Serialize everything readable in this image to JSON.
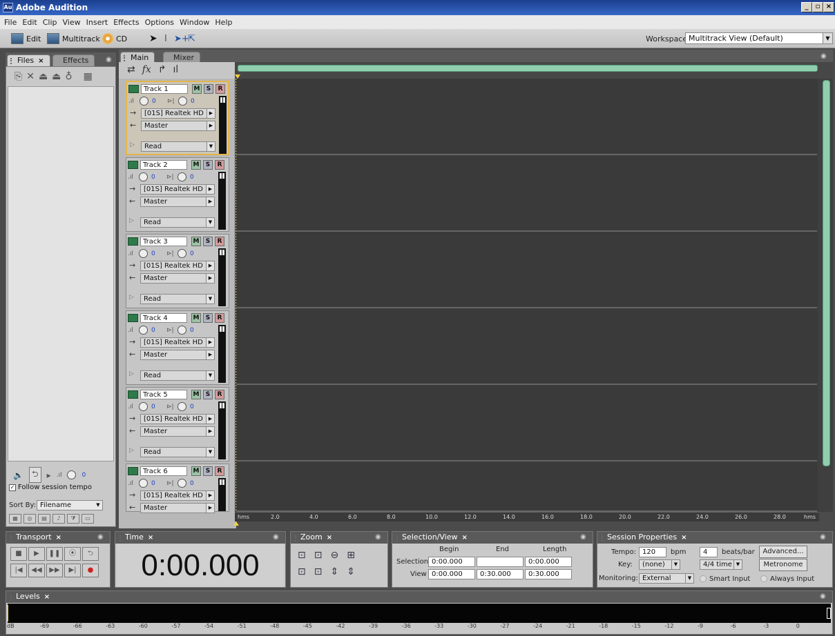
{
  "app": {
    "title": "Adobe Audition",
    "icon_label": "Au"
  },
  "menu": [
    "File",
    "Edit",
    "Clip",
    "View",
    "Insert",
    "Effects",
    "Options",
    "Window",
    "Help"
  ],
  "toolbar": {
    "edit_label": "Edit",
    "multitrack_label": "Multitrack",
    "cd_label": "CD",
    "workspace_label": "Workspace:",
    "workspace_value": "Multitrack View (Default)"
  },
  "left_panel": {
    "tabs": [
      "Files",
      "Effects"
    ],
    "follow_tempo": "Follow session tempo",
    "sort_by_label": "Sort By:",
    "sort_by_value": "Filename",
    "vol_value": "0"
  },
  "main_tabs": [
    "Main",
    "Mixer"
  ],
  "tracks": [
    {
      "name": "Track 1",
      "vol": "0",
      "pan": "0",
      "input": "[01S] Realtek HD",
      "output": "Master",
      "automation": "Read"
    },
    {
      "name": "Track 2",
      "vol": "0",
      "pan": "0",
      "input": "[01S] Realtek HD",
      "output": "Master",
      "automation": "Read"
    },
    {
      "name": "Track 3",
      "vol": "0",
      "pan": "0",
      "input": "[01S] Realtek HD",
      "output": "Master",
      "automation": "Read"
    },
    {
      "name": "Track 4",
      "vol": "0",
      "pan": "0",
      "input": "[01S] Realtek HD",
      "output": "Master",
      "automation": "Read"
    },
    {
      "name": "Track 5",
      "vol": "0",
      "pan": "0",
      "input": "[01S] Realtek HD",
      "output": "Master",
      "automation": "Read"
    },
    {
      "name": "Track 6",
      "vol": "0",
      "pan": "0",
      "input": "[01S] Realtek HD",
      "output": "Master",
      "automation": ""
    }
  ],
  "msr": [
    "M",
    "S",
    "R"
  ],
  "timeline": {
    "unit": "hms",
    "ticks": [
      "2.0",
      "4.0",
      "6.0",
      "8.0",
      "10.0",
      "12.0",
      "14.0",
      "16.0",
      "18.0",
      "20.0",
      "22.0",
      "24.0",
      "26.0",
      "28.0"
    ]
  },
  "transport": {
    "title": "Transport"
  },
  "time": {
    "title": "Time",
    "value": "0:00.000"
  },
  "zoom": {
    "title": "Zoom"
  },
  "selection_view": {
    "title": "Selection/View",
    "headers": [
      "Begin",
      "End",
      "Length"
    ],
    "selection_label": "Selection",
    "view_label": "View",
    "selection": [
      "0:00.000",
      "",
      "0:00.000"
    ],
    "view": [
      "0:00.000",
      "0:30.000",
      "0:30.000"
    ]
  },
  "session": {
    "title": "Session Properties",
    "tempo_label": "Tempo:",
    "tempo": "120",
    "bpm": "bpm",
    "beats": "4",
    "beats_label": "beats/bar",
    "advanced": "Advanced...",
    "key_label": "Key:",
    "key": "(none)",
    "time_sig": "4/4 time",
    "metronome": "Metronome",
    "monitoring_label": "Monitoring:",
    "monitoring": "External",
    "smart_input": "Smart Input",
    "always_input": "Always Input"
  },
  "levels": {
    "title": "Levels",
    "unit": "dB",
    "ticks": [
      "-69",
      "-66",
      "-63",
      "-60",
      "-57",
      "-54",
      "-51",
      "-48",
      "-45",
      "-42",
      "-39",
      "-36",
      "-33",
      "-30",
      "-27",
      "-24",
      "-21",
      "-18",
      "-15",
      "-12",
      "-9",
      "-6",
      "-3",
      "0"
    ]
  }
}
